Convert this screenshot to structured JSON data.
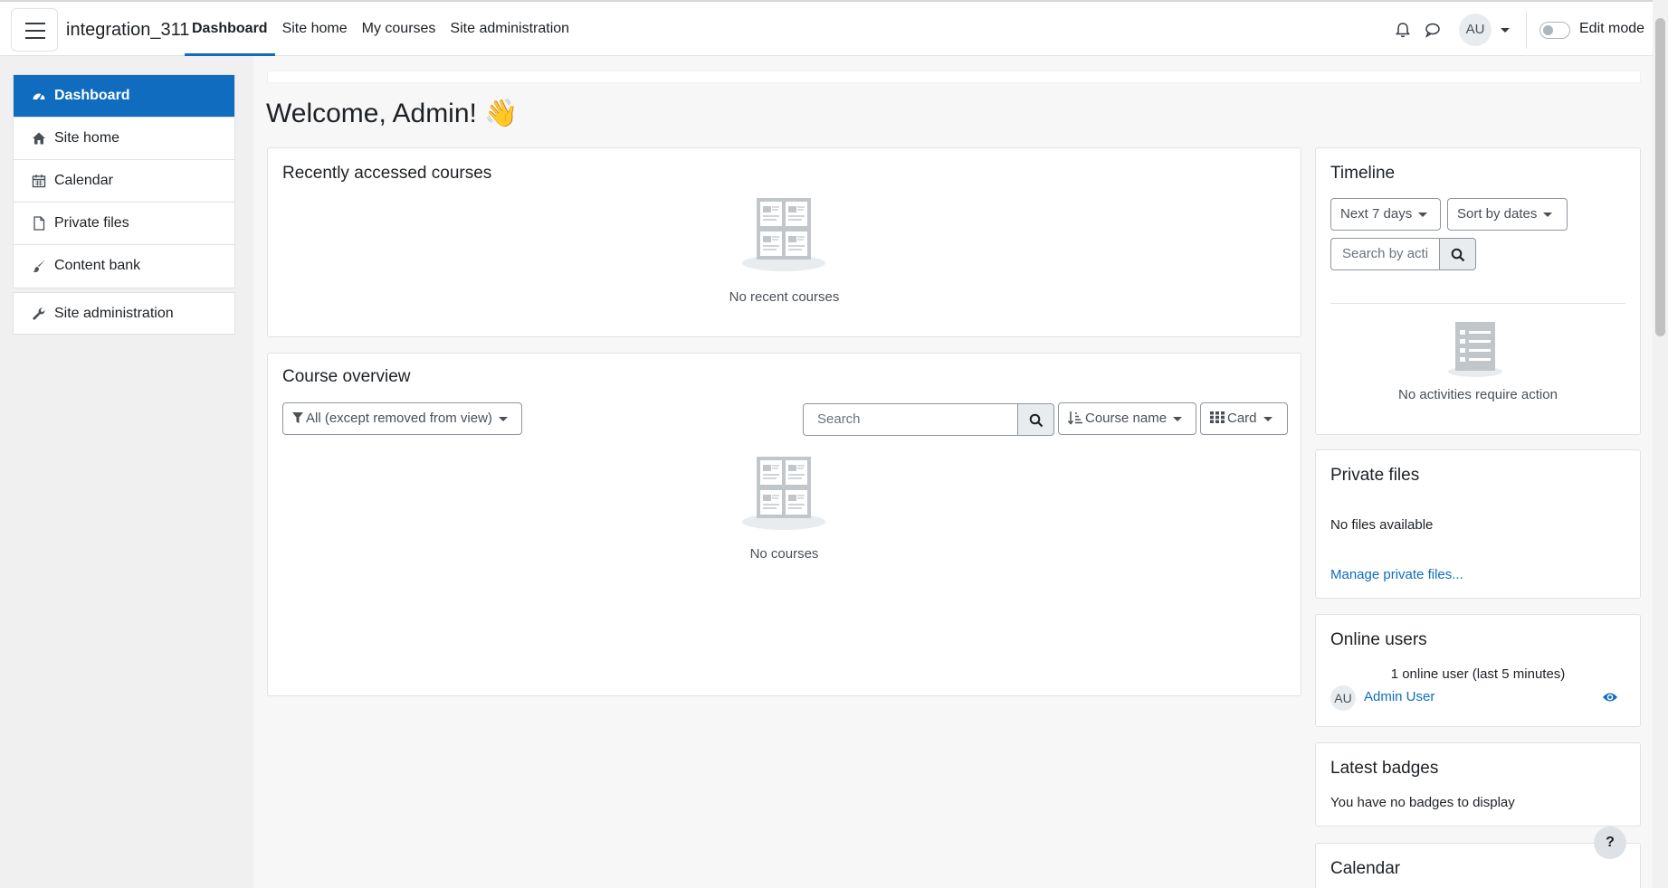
{
  "header": {
    "site_name": "integration_311",
    "nav": [
      "Dashboard",
      "Site home",
      "My courses",
      "Site administration"
    ],
    "active_nav": "Dashboard",
    "avatar_initials": "AU",
    "edit_mode_label": "Edit mode",
    "edit_mode_on": false
  },
  "drawer": {
    "items": [
      {
        "label": "Dashboard",
        "icon": "dashboard-icon"
      },
      {
        "label": "Site home",
        "icon": "home-icon"
      },
      {
        "label": "Calendar",
        "icon": "calendar-icon"
      },
      {
        "label": "Private files",
        "icon": "file-icon"
      },
      {
        "label": "Content bank",
        "icon": "brush-icon"
      }
    ],
    "admin_label": "Site administration"
  },
  "main": {
    "welcome": "Welcome, Admin! 👋",
    "recent": {
      "title": "Recently accessed courses",
      "empty": "No recent courses"
    },
    "overview": {
      "title": "Course overview",
      "filter": "All (except removed from view)",
      "search_placeholder": "Search",
      "sort": "Course name",
      "view": "Card",
      "empty": "No courses"
    }
  },
  "blocks": {
    "timeline": {
      "title": "Timeline",
      "range": "Next 7 days",
      "sort": "Sort by dates",
      "search_placeholder": "Search by acti",
      "empty": "No activities require action"
    },
    "private_files": {
      "title": "Private files",
      "empty": "No files available",
      "manage_link": "Manage private files..."
    },
    "online_users": {
      "title": "Online users",
      "summary": "1 online user (last 5 minutes)",
      "user_initials": "AU",
      "user_name": "Admin User"
    },
    "badges": {
      "title": "Latest badges",
      "empty": "You have no badges to display"
    },
    "calendar": {
      "title": "Calendar"
    }
  },
  "help_label": "?",
  "colors": {
    "primary": "#0f6cbf",
    "text": "#1d2125",
    "muted": "#495057",
    "border": "#dee2e6"
  }
}
